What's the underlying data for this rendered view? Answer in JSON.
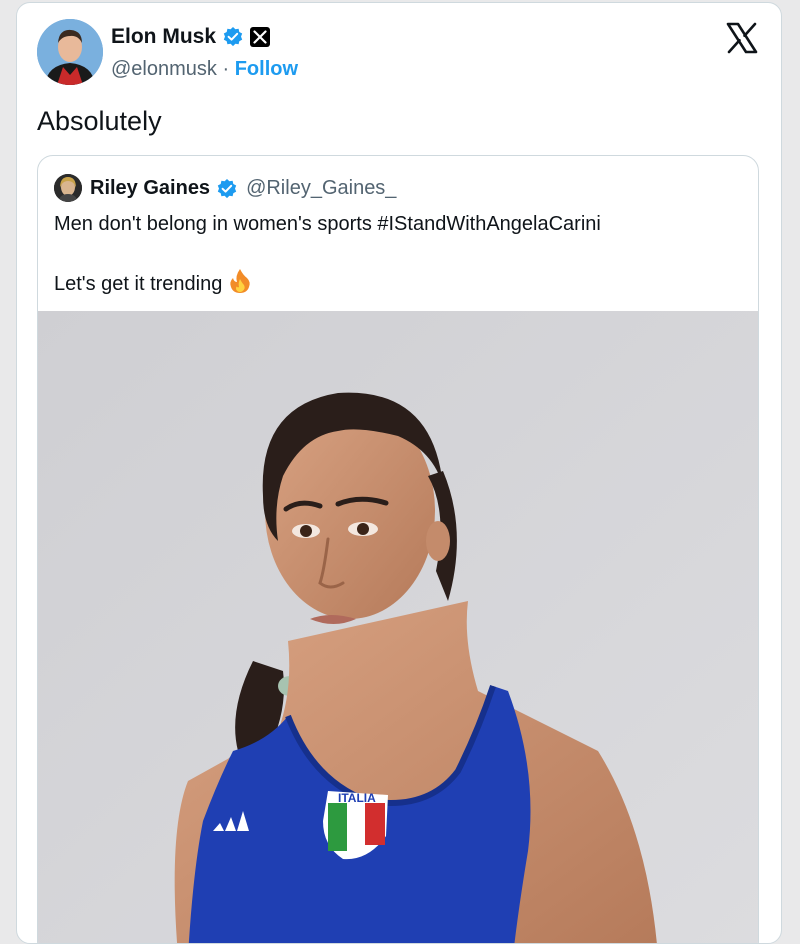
{
  "tweet": {
    "author_name": "Elon Musk",
    "author_handle": "@elonmusk",
    "separator": "·",
    "follow_label": "Follow",
    "text": "Absolutely"
  },
  "quote": {
    "author_name": "Riley Gaines",
    "author_handle": "@Riley_Gaines_",
    "line1": "Men don't belong in women's sports #IStandWithAngelaCarini",
    "line2": "Let's get it trending",
    "emoji": "fire-icon"
  },
  "photo": {
    "jersey_text": "ITALIA"
  },
  "colors": {
    "accent": "#1d9bf0",
    "verified": "#1d9bf0",
    "text": "#0f1419",
    "muted": "#536471",
    "jersey": "#1f3fb3"
  }
}
